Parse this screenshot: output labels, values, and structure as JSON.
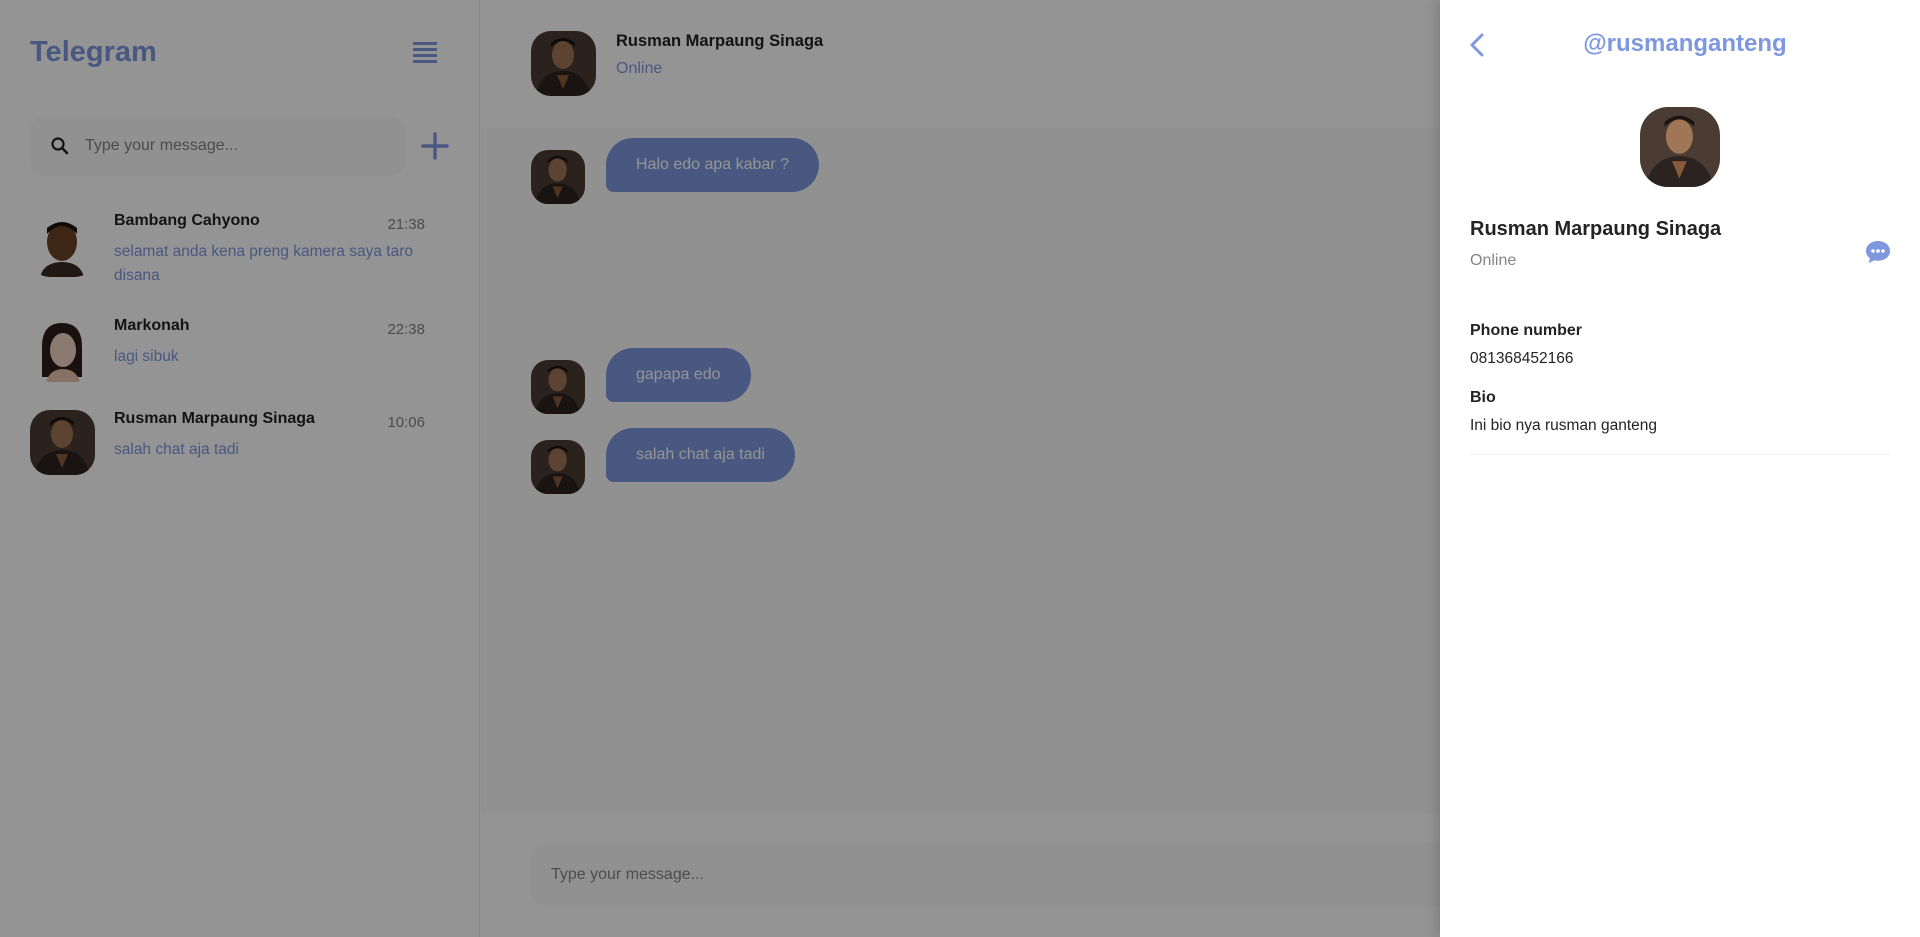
{
  "app": {
    "title": "Telegram"
  },
  "colors": {
    "accent": "#7e98df",
    "text": "#232323",
    "muted": "#848484",
    "danger": "#c0392b"
  },
  "search": {
    "placeholder": "Type your message..."
  },
  "chats": [
    {
      "name": "Bambang Cahyono",
      "time": "21:38",
      "preview": "selamat anda kena preng kamera saya taro disana"
    },
    {
      "name": "Markonah",
      "time": "22:38",
      "preview": "lagi sibuk"
    },
    {
      "name": "Rusman Marpaung Sinaga",
      "time": "10:06",
      "preview": "salah chat aja tadi"
    }
  ],
  "conversation": {
    "contact_name": "Rusman Marpaung Sinaga",
    "contact_status": "Online",
    "messages": [
      {
        "text": "Halo edo apa kabar ?"
      },
      {
        "text": "gapapa edo"
      },
      {
        "text": "salah chat aja tadi"
      }
    ],
    "composer_placeholder": "Type your message..."
  },
  "profile": {
    "username": "@rusmanganteng",
    "name": "Rusman Marpaung Sinaga",
    "status": "Online",
    "phone_label": "Phone number",
    "phone": "081368452166",
    "bio_label": "Bio",
    "bio": "Ini bio nya rusman ganteng"
  }
}
